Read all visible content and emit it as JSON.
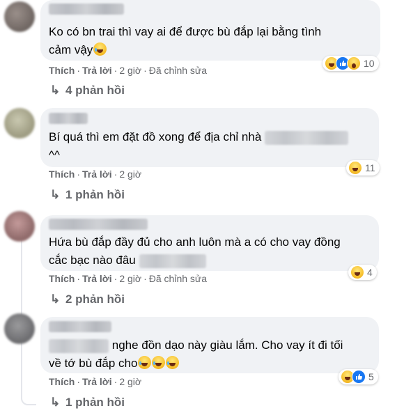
{
  "colors": {
    "bubble_bg": "#f0f2f5",
    "meta_text": "#65676b",
    "like_blue": "#1877f2",
    "haha_yellow": "#f7c12f"
  },
  "comments": [
    {
      "text_line1": "Ko có bn trai thì vay ai để được bù đắp lại bằng tình",
      "text_line2": "cảm vậy",
      "reactions": [
        "haha-icon",
        "like-icon",
        "wow-icon"
      ],
      "reaction_count": "10",
      "like_label": "Thích",
      "reply_label": "Trả lời",
      "time": "2 giờ",
      "edited": "Đã chỉnh sửa",
      "replies_label": "4 phản hồi"
    },
    {
      "text_line1": "Bí quá thì em đặt đồ xong để địa chỉ nhà",
      "text_line2": "^^",
      "reactions": [
        "haha-icon"
      ],
      "reaction_count": "11",
      "like_label": "Thích",
      "reply_label": "Trả lời",
      "time": "2 giờ",
      "replies_label": "1 phản hồi"
    },
    {
      "text_line1": "Hứa bù đắp đầy đủ cho anh luôn mà a có cho vay đồng",
      "text_line2": "cắc bạc nào đâu",
      "reactions": [
        "haha-icon"
      ],
      "reaction_count": "4",
      "like_label": "Thích",
      "reply_label": "Trả lời",
      "time": "2 giờ",
      "edited": "Đã chỉnh sửa",
      "replies_label": "2 phản hồi"
    },
    {
      "text_line1": "nghe đồn dạo này giàu lắm. Cho vay ít đi tối",
      "text_line2": "về tớ bù đắp cho",
      "reactions": [
        "haha-icon",
        "like-icon"
      ],
      "reaction_count": "5",
      "like_label": "Thích",
      "reply_label": "Trả lời",
      "time": "2 giờ",
      "replies_label": "1 phản hồi"
    }
  ],
  "separator": "·",
  "reply_arrow": "↳"
}
